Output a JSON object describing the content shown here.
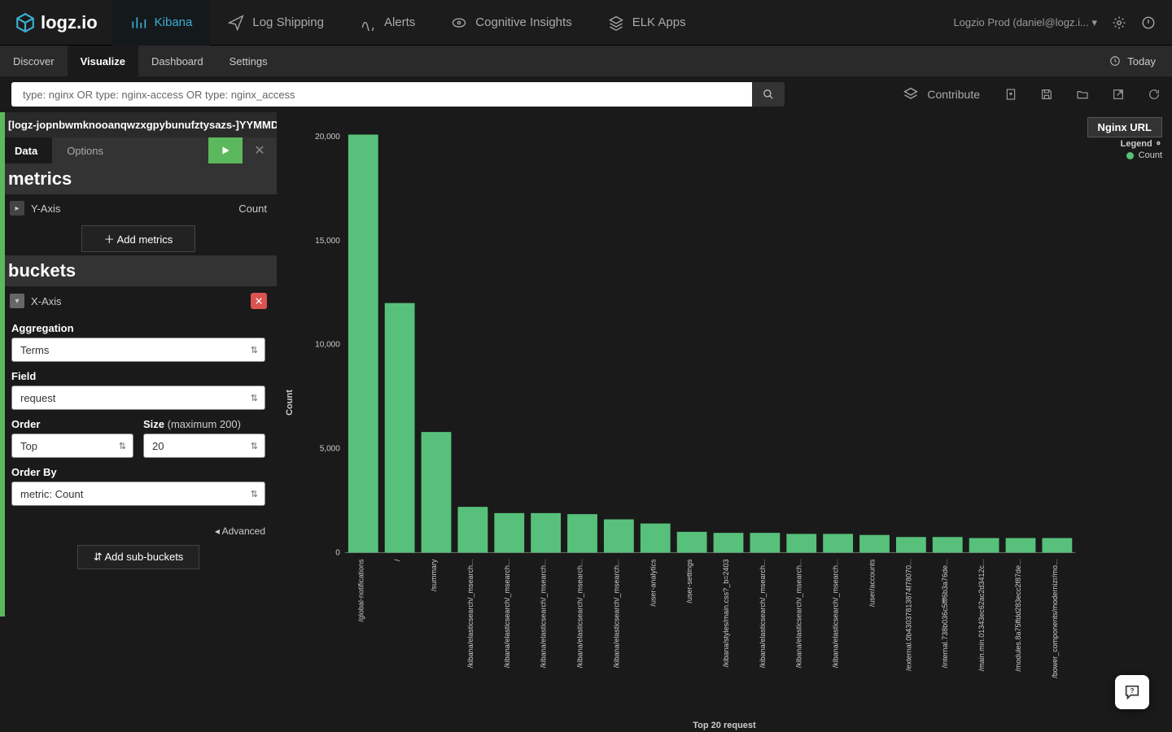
{
  "brand": "logz.io",
  "nav": {
    "items": [
      "Kibana",
      "Log Shipping",
      "Alerts",
      "Cognitive Insights",
      "ELK Apps"
    ],
    "active": 0,
    "account": "Logzio Prod (daniel@logz.i...",
    "caret": "▾"
  },
  "subnav": {
    "items": [
      "Discover",
      "Visualize",
      "Dashboard",
      "Settings"
    ],
    "active": 1,
    "right": "Today"
  },
  "search": {
    "value": "type: nginx OR type: nginx-access OR type: nginx_access",
    "contribute": "Contribute"
  },
  "sidebar": {
    "index": "[logz-jopnbwmknooanqwzxgpybunufztysazs-]YYMMDD",
    "tabs": {
      "data": "Data",
      "options": "Options"
    },
    "metrics_title": "metrics",
    "yaxis": "Y-Axis",
    "yaxis_value": "Count",
    "add_metrics": "＋ Add metrics",
    "buckets_title": "buckets",
    "xaxis": "X-Axis",
    "agg_label": "Aggregation",
    "agg_val": "Terms",
    "field_label": "Field",
    "field_val": "request",
    "order_label": "Order",
    "order_val": "Top",
    "size_label": "Size",
    "size_hint": "(maximum 200)",
    "size_val": "20",
    "orderby_label": "Order By",
    "orderby_val": "metric: Count",
    "advanced": "◂ Advanced",
    "add_sub": "⇵ Add sub-buckets"
  },
  "chart": {
    "title": "Nginx URL",
    "legend_title": "Legend ⚬",
    "legend_item": "Count",
    "ylabel": "Count",
    "xlabel": "Top 20 request"
  },
  "chart_data": {
    "type": "bar",
    "title": "Nginx URL",
    "xlabel": "Top 20 request",
    "ylabel": "Count",
    "ylim": [
      0,
      20000
    ],
    "yticks": [
      0,
      5000,
      10000,
      15000,
      20000
    ],
    "categories": [
      "/global-notifications",
      "/",
      "/summary",
      "/kibana/elasticsearch/_msearch...",
      "/kibana/elasticsearch/_msearch...",
      "/kibana/elasticsearch/_msearch...",
      "/kibana/elasticsearch/_msearch...",
      "/kibana/elasticsearch/_msearch...",
      "/user-analytics",
      "/user-settings",
      "/kibana/styles/main.css?_b=2403",
      "/kibana/elasticsearch/_msearch...",
      "/kibana/elasticsearch/_msearch...",
      "/kibana/elasticsearch/_msearch...",
      "/user/accounts",
      "/external.0b43037813874f78070...",
      "/internal.738b036c5fff6b3a76de...",
      "/main.min.01343ec62ac2d3412c...",
      "/modules.8a75ffdd283ecc2f87de...",
      "/bower_components/modernizr/mo..."
    ],
    "values": [
      20100,
      12000,
      5800,
      2200,
      1900,
      1900,
      1850,
      1600,
      1400,
      1000,
      950,
      950,
      900,
      900,
      850,
      750,
      750,
      700,
      700,
      700
    ]
  }
}
